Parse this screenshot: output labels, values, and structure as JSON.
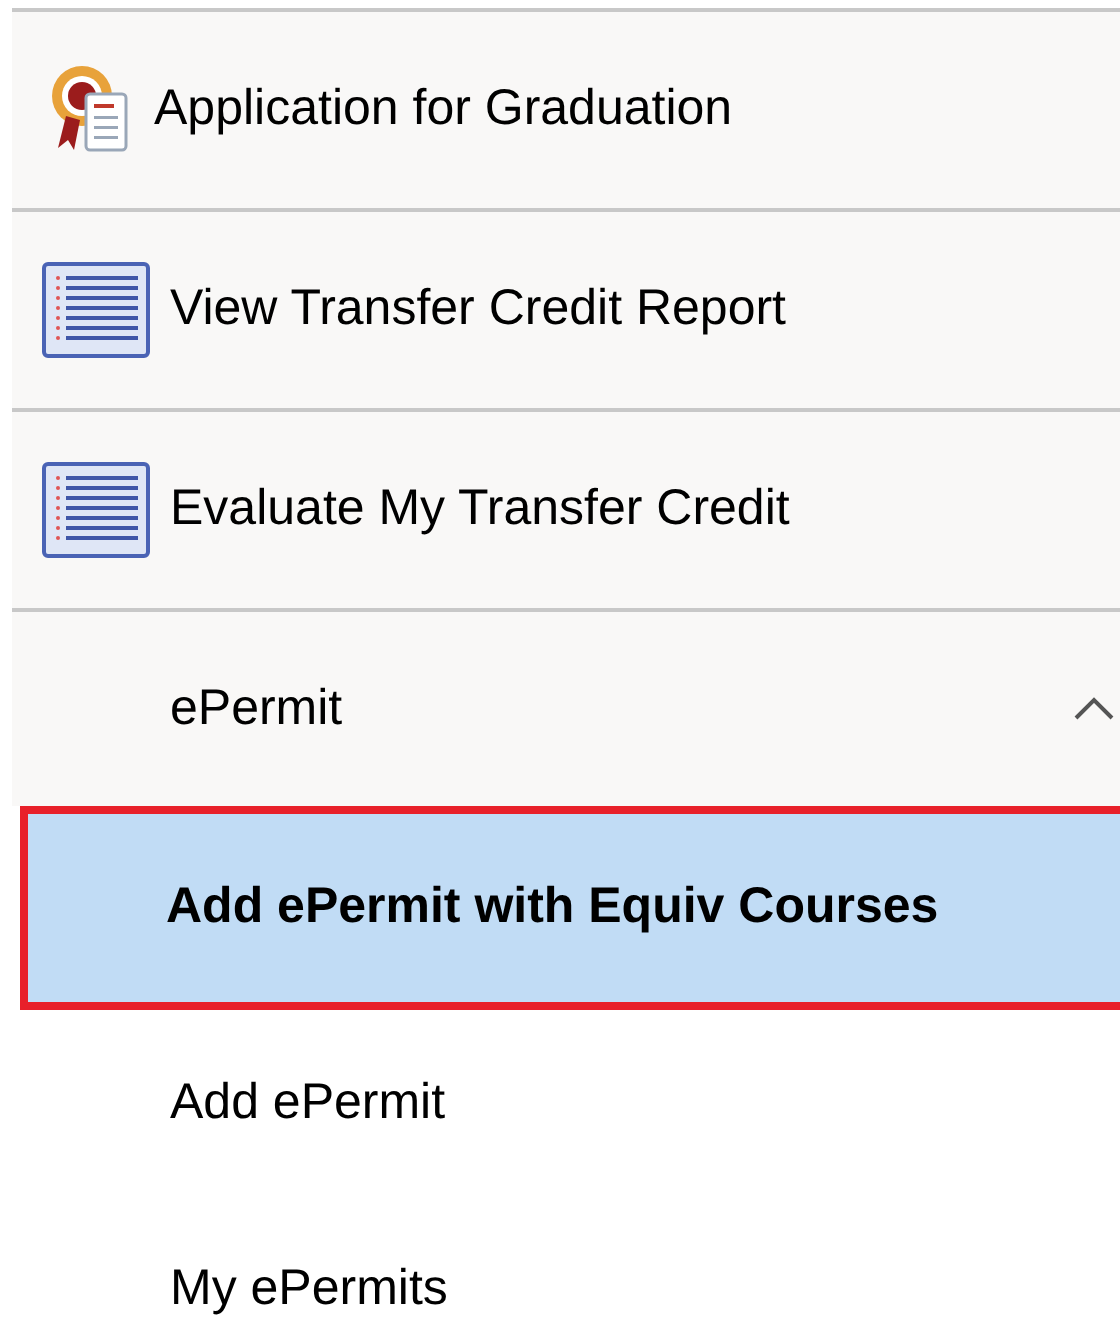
{
  "menu": [
    {
      "kind": "certificate",
      "label": "Application for Graduation"
    },
    {
      "kind": "list",
      "label": "View Transfer Credit Report"
    },
    {
      "kind": "list",
      "label": "Evaluate My Transfer Credit"
    },
    {
      "kind": "group",
      "label": "ePermit",
      "expanded": true,
      "children": [
        {
          "label": "Add ePermit with Equiv Courses",
          "selected": true
        },
        {
          "label": "Add ePermit",
          "selected": false
        },
        {
          "label": "My ePermits",
          "selected": false
        }
      ]
    }
  ]
}
